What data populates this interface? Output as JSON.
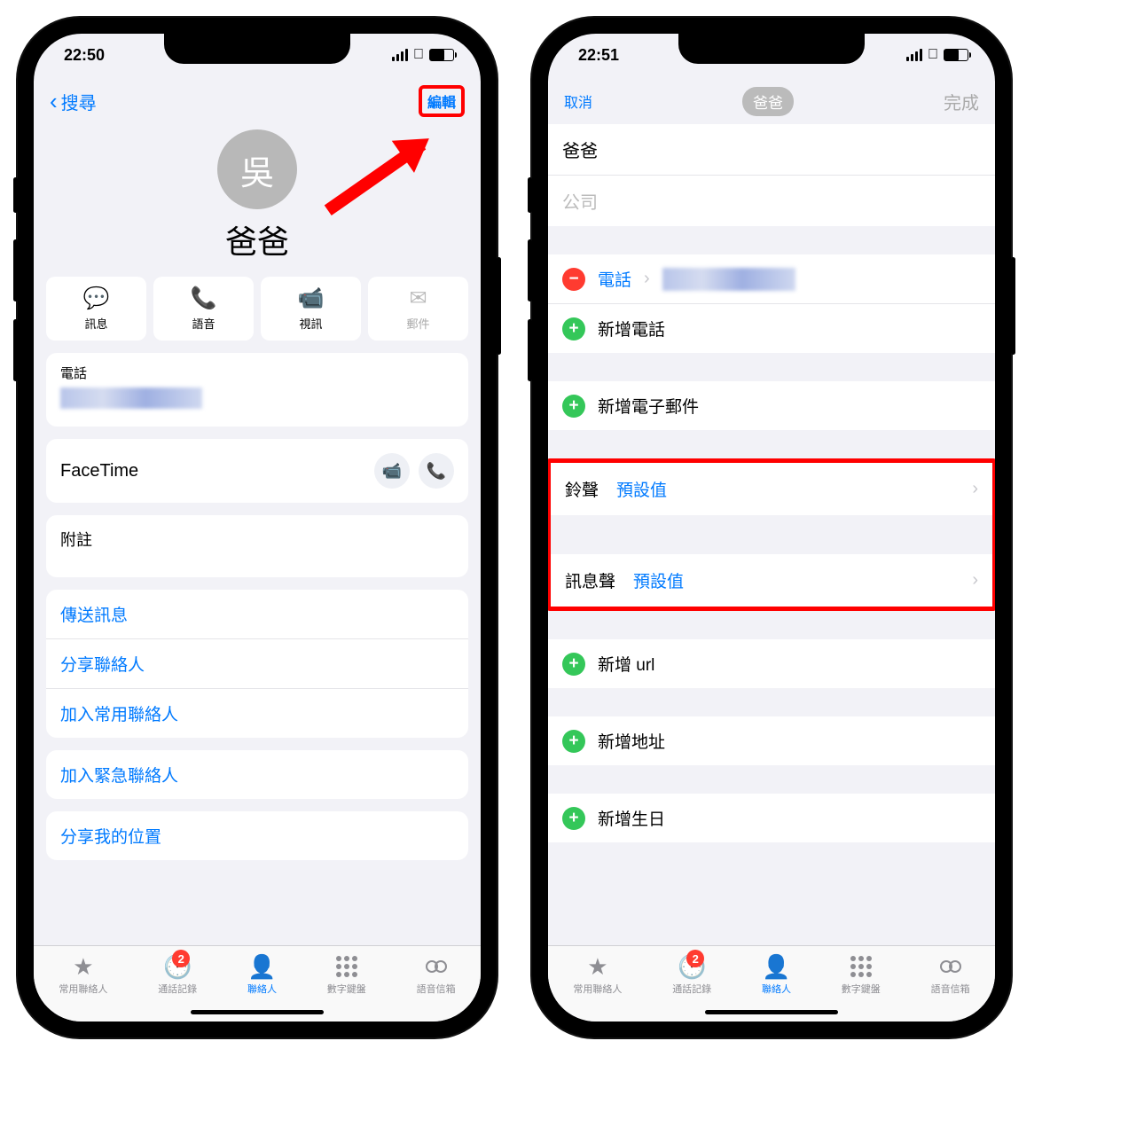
{
  "left": {
    "status": {
      "time": "22:50"
    },
    "nav": {
      "back": "搜尋",
      "edit": "編輯"
    },
    "avatar_initial": "吳",
    "contact_name": "爸爸",
    "actions": {
      "message": "訊息",
      "voice": "語音",
      "video": "視訊",
      "mail": "郵件"
    },
    "phone_label": "電話",
    "facetime_label": "FaceTime",
    "notes_label": "附註",
    "links": {
      "send_message": "傳送訊息",
      "share_contact": "分享聯絡人",
      "add_favorite": "加入常用聯絡人",
      "add_emergency": "加入緊急聯絡人",
      "share_location": "分享我的位置"
    }
  },
  "right": {
    "status": {
      "time": "22:51"
    },
    "nav": {
      "cancel": "取消",
      "chip": "爸爸",
      "done": "完成"
    },
    "fields": {
      "name": "爸爸",
      "company_ph": "公司",
      "phone_label": "電話",
      "add_phone": "新增電話",
      "add_email": "新增電子郵件",
      "ringtone_label": "鈴聲",
      "ringtone_value": "預設值",
      "texttone_label": "訊息聲",
      "texttone_value": "預設值",
      "add_url": "新增 url",
      "add_address": "新增地址",
      "add_birthday": "新增生日"
    }
  },
  "tabs": {
    "favorites": "常用聯絡人",
    "recents": "通話記錄",
    "recents_badge": "2",
    "contacts": "聯絡人",
    "keypad": "數字鍵盤",
    "voicemail": "語音信箱"
  }
}
